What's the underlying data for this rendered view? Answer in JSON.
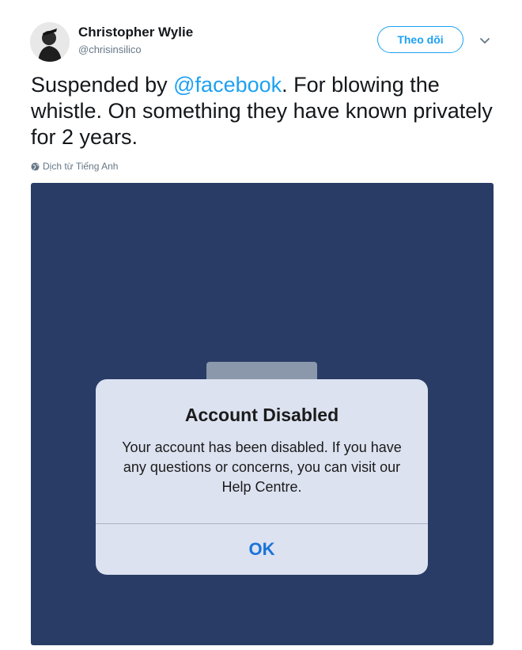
{
  "author": {
    "name": "Christopher Wylie",
    "handle": "@chrisinsilico"
  },
  "follow_label": "Theo dõi",
  "tweet": {
    "pre": "Suspended by ",
    "mention": "@facebook",
    "post": ". For blowing the whistle. On something they have known privately for 2 years."
  },
  "translate_label": "Dịch từ Tiếng Anh",
  "dialog": {
    "title": "Account Disabled",
    "body": "Your account has been disabled. If you have any questions or concerns, you can visit our Help Centre.",
    "ok_label": "OK"
  },
  "colors": {
    "accent": "#1da1f2",
    "media_background": "#283c66",
    "ios_blue": "#1a73d9"
  }
}
